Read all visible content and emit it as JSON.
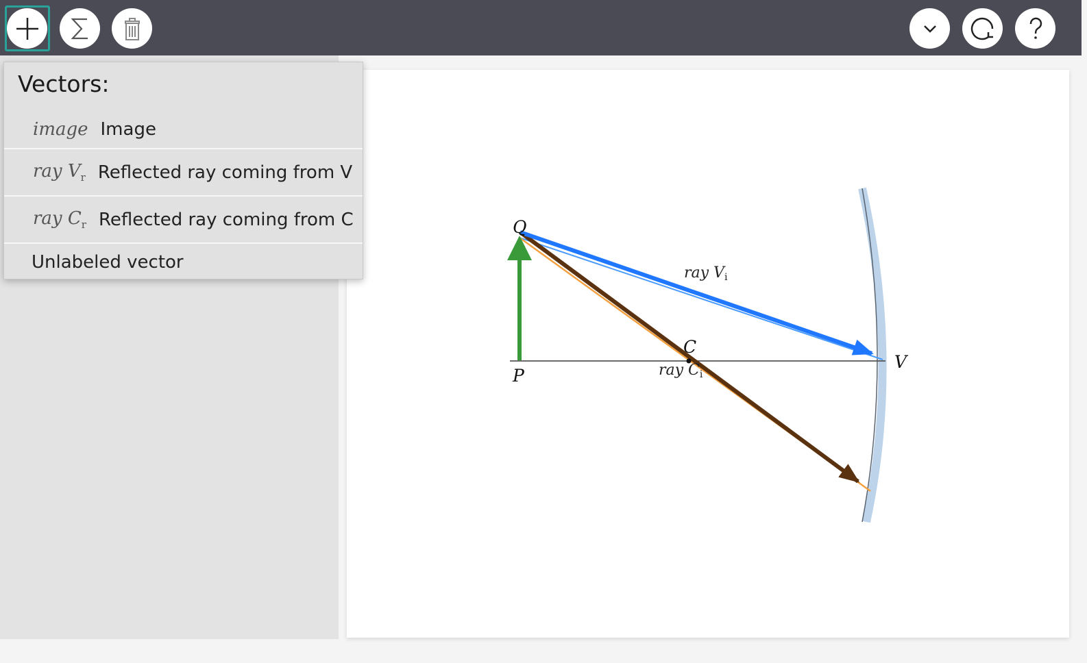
{
  "toolbar": {
    "add_icon": "plus-icon",
    "sum_icon": "sigma-icon",
    "delete_icon": "trash-icon",
    "collapse_icon": "chevron-down-icon",
    "reset_icon": "refresh-icon",
    "help_icon": "question-icon"
  },
  "menu": {
    "title": "Vectors:",
    "items": [
      {
        "symbol": "image",
        "subscript": "",
        "label": "Image"
      },
      {
        "symbol": "ray V",
        "subscript": "r",
        "label": "Reflected ray coming from V"
      },
      {
        "symbol": "ray C",
        "subscript": "r",
        "label": "Reflected ray coming from C"
      },
      {
        "symbol": "",
        "subscript": "",
        "label": "Unlabeled vector"
      }
    ]
  },
  "diagram": {
    "point_labels": {
      "object_top": "Q",
      "object_base": "P",
      "center": "C",
      "vertex": "V"
    },
    "ray_labels": {
      "incident_v": "ray V",
      "incident_v_sub": "i",
      "incident_c": "ray C",
      "incident_c_sub": "i"
    },
    "colors": {
      "object_arrow": "#3a9a3a",
      "ray_v": "#1f78ff",
      "ray_v_thin": "#4a9bff",
      "ray_c": "#5a3210",
      "ray_c_thin": "#f5a040",
      "axis": "#555555",
      "mirror": "#bcd3ea",
      "mirror_edge": "#5a6470"
    }
  }
}
